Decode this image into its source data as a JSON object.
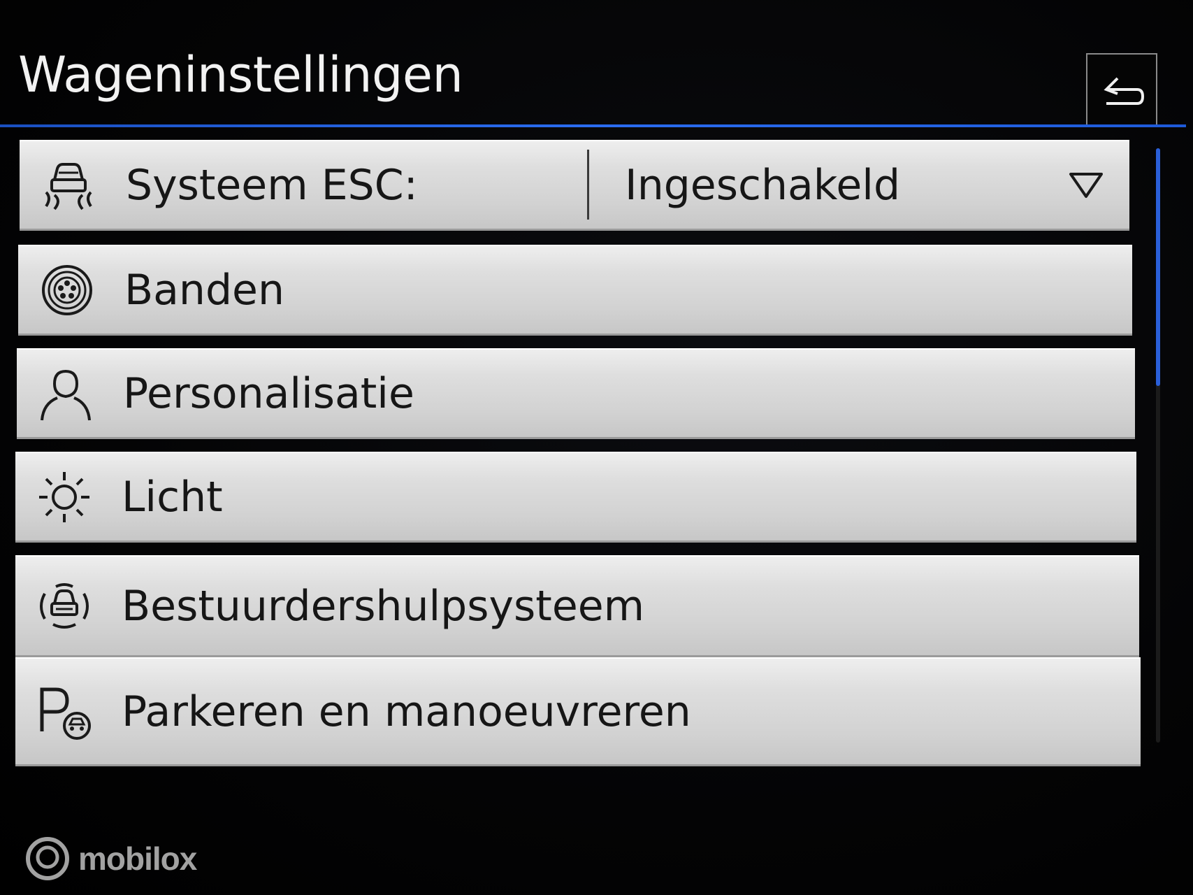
{
  "header": {
    "title": "Wageninstellingen",
    "back_icon": "back-arrow-icon",
    "accent_color": "#2a6cf0"
  },
  "menu": {
    "items": [
      {
        "label": "Systeem ESC:",
        "value": "Ingeschakeld",
        "icon": "esc-skid-car-icon",
        "has_dropdown": true
      },
      {
        "label": "Banden",
        "icon": "tire-icon"
      },
      {
        "label": "Personalisatie",
        "icon": "person-icon"
      },
      {
        "label": "Licht",
        "icon": "light-sun-icon"
      },
      {
        "label": "Bestuurdershulpsysteem",
        "icon": "driver-assist-car-icon"
      },
      {
        "label": "Parkeren en manoeuvreren",
        "icon": "parking-icon"
      }
    ]
  },
  "scrollbar": {
    "visible_fraction": 0.4
  },
  "watermark": {
    "text": "mobilox",
    "icon": "mobilox-logo-icon"
  }
}
